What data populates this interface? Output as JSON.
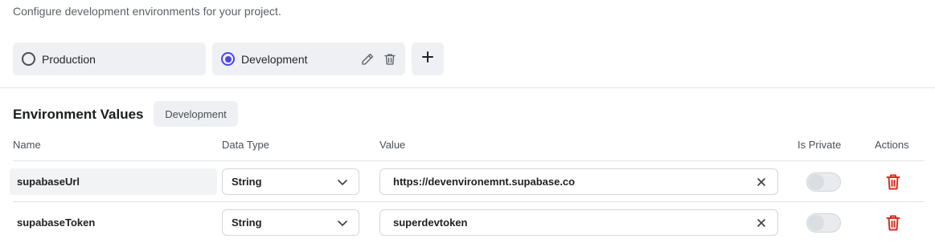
{
  "header": {
    "subtitle": "Configure development environments for your project."
  },
  "environments": [
    {
      "label": "Production",
      "selected": false
    },
    {
      "label": "Development",
      "selected": true
    }
  ],
  "env_actions": {
    "edit_icon": "pencil-icon",
    "delete_icon": "trash-icon",
    "add_icon": "plus-icon"
  },
  "section": {
    "title": "Environment Values",
    "badge": "Development"
  },
  "table": {
    "columns": [
      "Name",
      "Data Type",
      "Value",
      "Is Private",
      "Actions"
    ],
    "rows": [
      {
        "name": "supabaseUrl",
        "type": "String",
        "value": "https://devenvironemnt.supabase.co",
        "is_private": false
      },
      {
        "name": "supabaseToken",
        "type": "String",
        "value": "superdevtoken",
        "is_private": false
      }
    ]
  },
  "colors": {
    "accent": "#4f46e5",
    "delete": "#d92d20",
    "card_bg": "#eef0f4"
  }
}
